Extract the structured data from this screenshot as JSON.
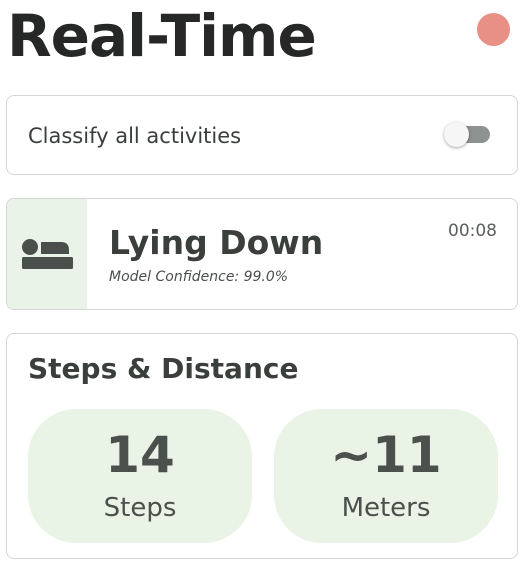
{
  "header": {
    "title": "Real-Time",
    "status_color": "#e88f86"
  },
  "classify": {
    "label": "Classify all activities",
    "toggle_on": false
  },
  "activity": {
    "icon": "bed-icon",
    "name": "Lying Down",
    "confidence_text": "Model Confidence: 99.0%",
    "timer": "00:08"
  },
  "steps_distance": {
    "title": "Steps & Distance",
    "steps": {
      "value": "14",
      "unit": "Steps"
    },
    "meters": {
      "value": "~11",
      "unit": "Meters"
    }
  },
  "colors": {
    "accent_bg": "#eaf3e8",
    "text_dark": "#3a3f3c",
    "status_dot": "#e88f86"
  }
}
